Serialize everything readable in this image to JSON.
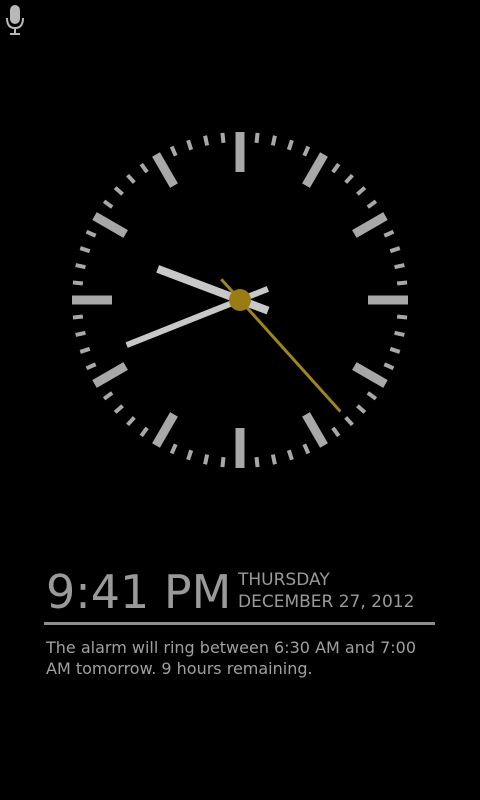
{
  "status_bar": {
    "icon": "microphone-icon"
  },
  "clock": {
    "hour": 9,
    "minute": 41,
    "second": 23,
    "tick_color": "#a8a8a8",
    "hand_color": "#c8c8c8",
    "second_hand_color": "#a0841c",
    "hub_color": "#9b7b14"
  },
  "time_display": {
    "time": "9:41 PM",
    "day": "THURSDAY",
    "date": "DECEMBER 27, 2012"
  },
  "alarm": {
    "message": "The alarm will ring between 6:30 AM and 7:00 AM tomorrow. 9 hours remaining."
  }
}
